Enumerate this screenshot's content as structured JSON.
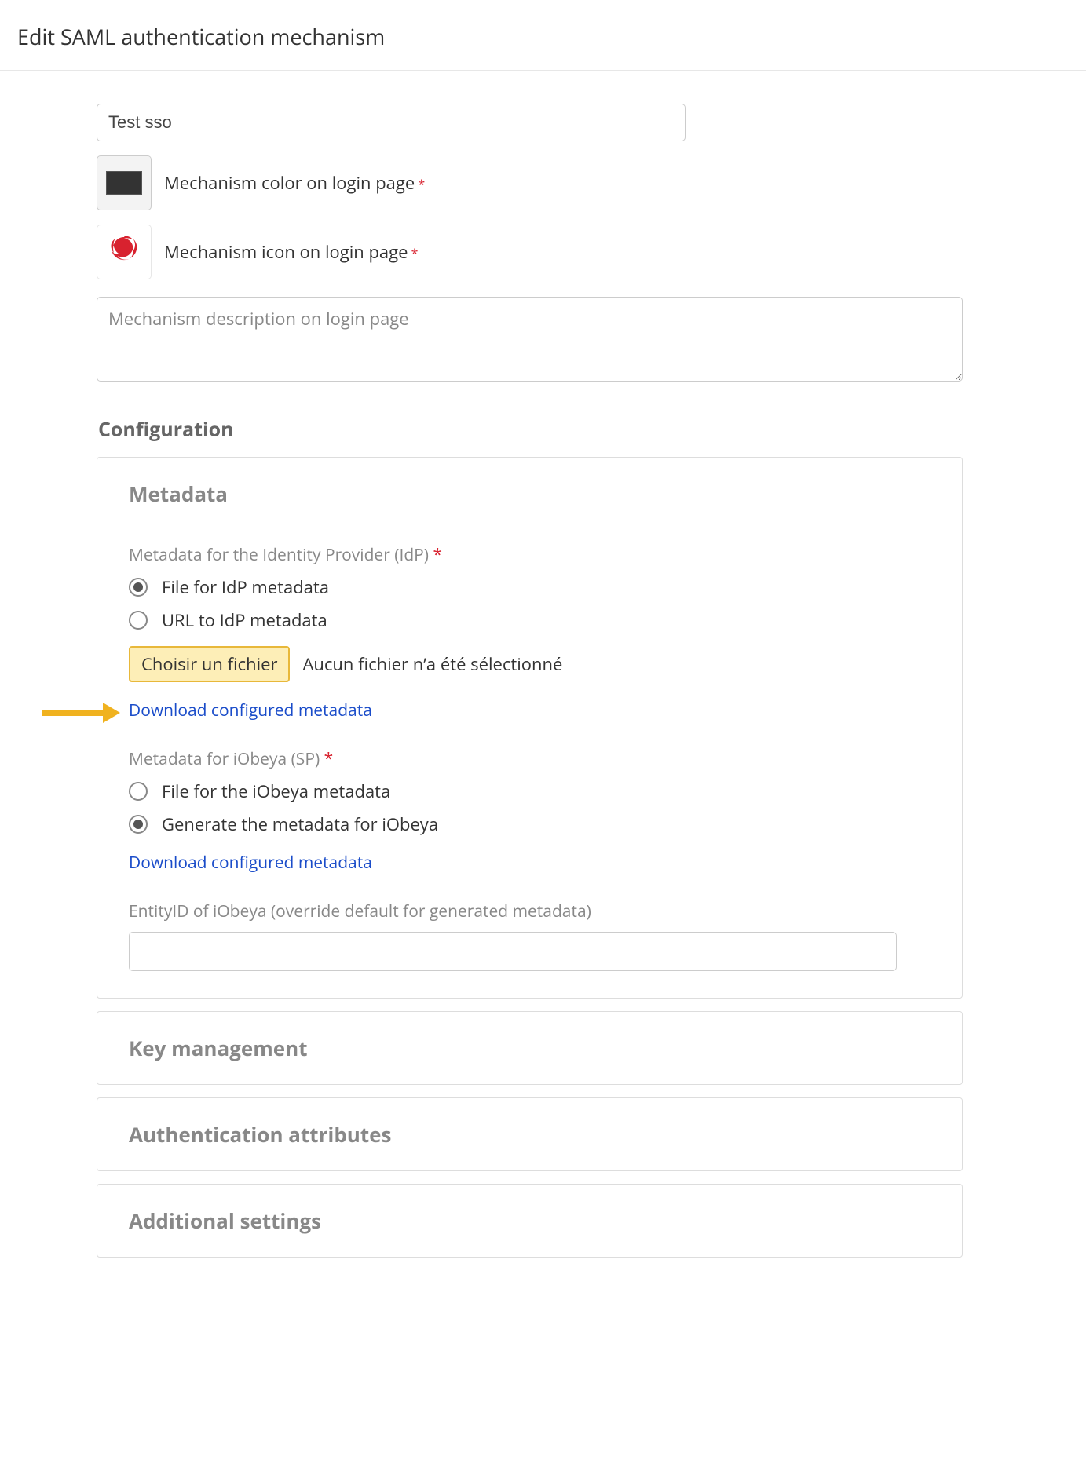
{
  "page": {
    "title": "Edit SAML authentication mechanism"
  },
  "form": {
    "name_value": "Test sso",
    "color_label": "Mechanism color on login page",
    "color_value": "#333333",
    "icon_label": "Mechanism icon on login page",
    "description_placeholder": "Mechanism description on login page",
    "description_value": ""
  },
  "configuration": {
    "heading": "Configuration",
    "metadata": {
      "title": "Metadata",
      "idp": {
        "label": "Metadata for the Identity Provider (IdP)",
        "option_file": "File for IdP metadata",
        "option_url": "URL to IdP metadata",
        "selected": "file",
        "file_button": "Choisir un fichier",
        "file_status": "Aucun fichier n’a été sélectionné",
        "download_link": "Download configured metadata"
      },
      "sp": {
        "label": "Metadata for iObeya (SP)",
        "option_file": "File for the iObeya metadata",
        "option_generate": "Generate the metadata for iObeya",
        "selected": "generate",
        "download_link": "Download configured metadata",
        "entity_label": "EntityID of iObeya (override default for generated metadata)",
        "entity_value": ""
      }
    },
    "key_management": {
      "title": "Key management"
    },
    "auth_attributes": {
      "title": "Authentication attributes"
    },
    "additional_settings": {
      "title": "Additional settings"
    }
  },
  "callout": {
    "arrow_color": "#f0b21f"
  }
}
